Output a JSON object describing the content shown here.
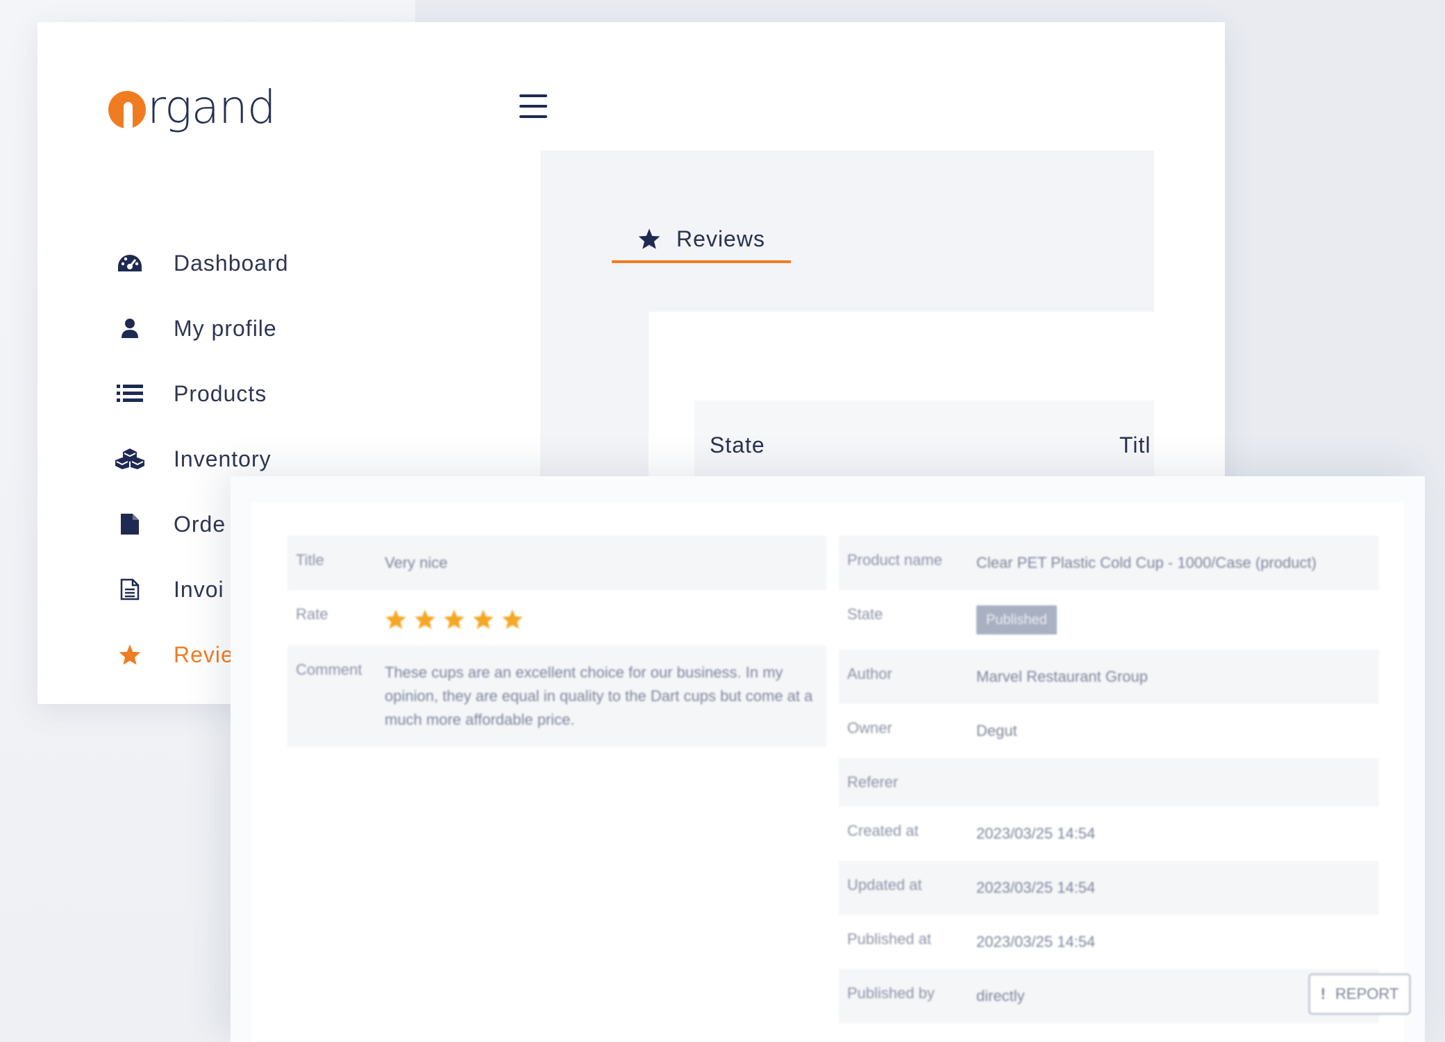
{
  "brand": {
    "logo_text": "rgand",
    "accent": "#f07c22",
    "navy": "#1e2a52"
  },
  "sidebar": {
    "items": [
      {
        "label": "Dashboard",
        "icon": "dashboard-gauge-icon"
      },
      {
        "label": "My profile",
        "icon": "user-icon"
      },
      {
        "label": "Products",
        "icon": "list-icon"
      },
      {
        "label": "Inventory",
        "icon": "boxes-icon"
      },
      {
        "label": "Orde",
        "icon": "file-icon"
      },
      {
        "label": "Invoi",
        "icon": "document-icon"
      },
      {
        "label": "Revie",
        "icon": "star-icon",
        "active": true
      }
    ]
  },
  "main": {
    "tab_label": "Reviews",
    "table_headers": [
      "State",
      "Titl"
    ]
  },
  "review": {
    "left": [
      {
        "label": "Title",
        "value": "Very nice"
      },
      {
        "label": "Rate",
        "value": "",
        "stars": 5
      },
      {
        "label": "Comment",
        "value": "These cups are an excellent choice for our business. In my opinion, they are equal in quality to the Dart cups but come at a much more affordable price."
      }
    ],
    "right": [
      {
        "label": "Product name",
        "value": "Clear PET Plastic Cold Cup - 1000/Case (product)"
      },
      {
        "label": "State",
        "value": "Published",
        "badge": true
      },
      {
        "label": "Author",
        "value": "Marvel Restaurant Group"
      },
      {
        "label": "Owner",
        "value": "Degut"
      },
      {
        "label": "Referer",
        "value": ""
      },
      {
        "label": "Created at",
        "value": "2023/03/25 14:54"
      },
      {
        "label": "Updated at",
        "value": "2023/03/25 14:54"
      },
      {
        "label": "Published at",
        "value": "2023/03/25 14:54"
      },
      {
        "label": "Published by",
        "value": "directly"
      }
    ],
    "report_label": "REPORT"
  }
}
